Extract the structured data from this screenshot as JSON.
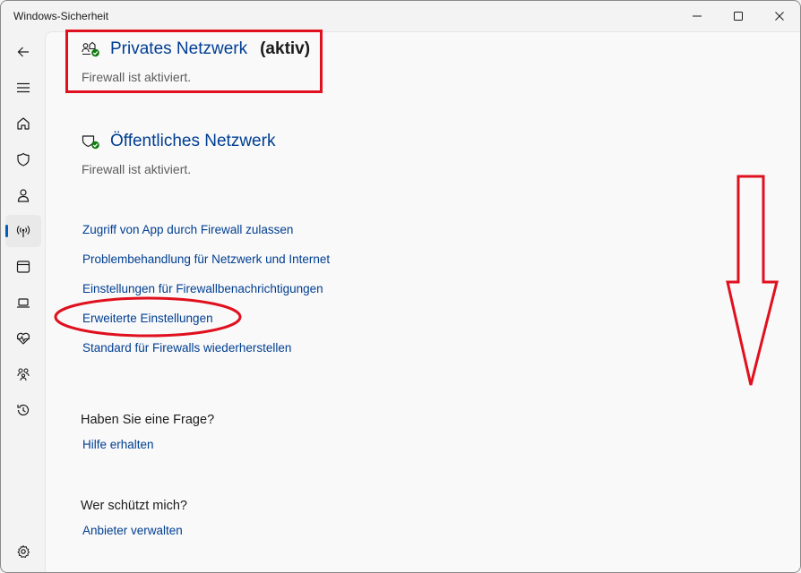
{
  "window": {
    "title": "Windows-Sicherheit",
    "controls": [
      "minimize",
      "maximize",
      "close"
    ]
  },
  "nav": {
    "items": [
      {
        "name": "back",
        "icon": "back-arrow-icon"
      },
      {
        "name": "menu",
        "icon": "hamburger-icon"
      },
      {
        "name": "home",
        "icon": "home-icon"
      },
      {
        "name": "virus-protection",
        "icon": "shield-icon"
      },
      {
        "name": "account-protection",
        "icon": "person-icon"
      },
      {
        "name": "firewall-network",
        "icon": "antenna-icon",
        "active": true
      },
      {
        "name": "app-browser-control",
        "icon": "browser-window-icon"
      },
      {
        "name": "device-security",
        "icon": "laptop-icon"
      },
      {
        "name": "device-health",
        "icon": "heart-pulse-icon"
      },
      {
        "name": "family-options",
        "icon": "family-icon"
      },
      {
        "name": "protection-history",
        "icon": "history-icon"
      },
      {
        "name": "settings",
        "icon": "gear-icon"
      }
    ]
  },
  "private_network": {
    "title": "Privates Netzwerk",
    "active_label": "(aktiv)",
    "status": "Firewall ist aktiviert.",
    "icon": "private-network-check-icon"
  },
  "public_network": {
    "title": "Öffentliches Netzwerk",
    "status": "Firewall ist aktiviert.",
    "icon": "public-network-check-icon"
  },
  "links": [
    "Zugriff von App durch Firewall zulassen",
    "Problembehandlung für Netzwerk und Internet",
    "Einstellungen für Firewallbenachrichtigungen",
    "Erweiterte Einstellungen",
    "Standard für Firewalls wiederherstellen"
  ],
  "help": {
    "heading": "Haben Sie eine Frage?",
    "link": "Hilfe erhalten"
  },
  "protector": {
    "heading": "Wer schützt mich?",
    "link": "Anbieter verwalten"
  },
  "colors": {
    "link": "#003e92",
    "annotation": "#e0101e",
    "check": "#0f7b0f",
    "accent": "#005fb8"
  }
}
